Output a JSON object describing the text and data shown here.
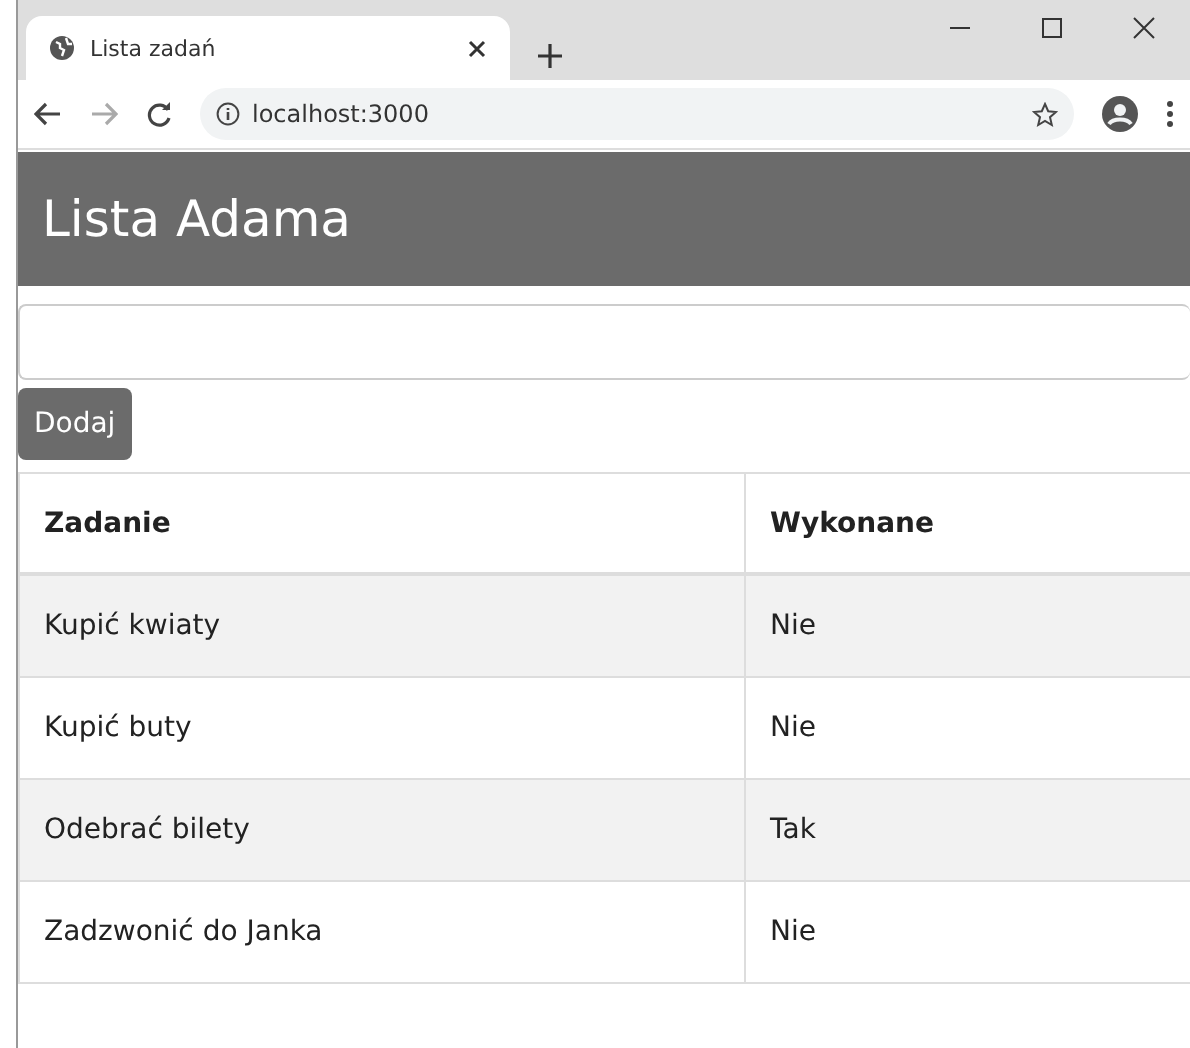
{
  "browser": {
    "tab_title": "Lista zadań",
    "url": "localhost:3000"
  },
  "page": {
    "heading": "Lista Adama",
    "add_button": "Dodaj"
  },
  "table": {
    "columns": [
      "Zadanie",
      "Wykonane"
    ],
    "rows": [
      {
        "task": "Kupić kwiaty",
        "done": "Nie"
      },
      {
        "task": "Kupić buty",
        "done": "Nie"
      },
      {
        "task": "Odebrać bilety",
        "done": "Tak"
      },
      {
        "task": "Zadzwonić do Janka",
        "done": "Nie"
      }
    ]
  }
}
